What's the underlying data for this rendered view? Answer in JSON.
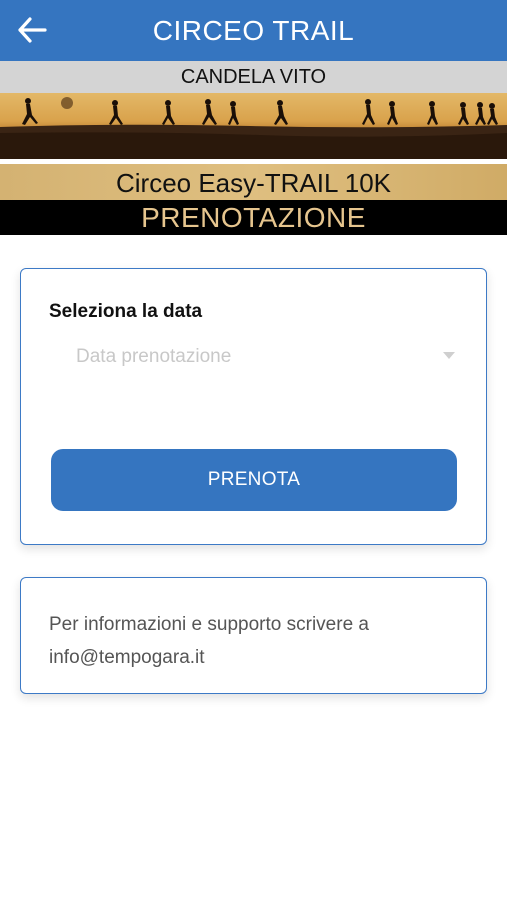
{
  "header": {
    "title": "CIRCEO TRAIL",
    "back_icon": "arrow-left-icon",
    "color": "#3575c0"
  },
  "user": {
    "name": "CANDELA VITO"
  },
  "banner": {
    "event_name": "Circeo Easy-TRAIL 10K",
    "section_title": "PRENOTAZIONE",
    "image": "runners-silhouette-sunset"
  },
  "booking": {
    "label": "Seleziona la data",
    "date_placeholder": "Data prenotazione",
    "dropdown_icon": "caret-down-icon",
    "submit_label": "PRENOTA"
  },
  "info": {
    "text": "Per informazioni e supporto scrivere a",
    "email": "info@tempogara.it"
  }
}
